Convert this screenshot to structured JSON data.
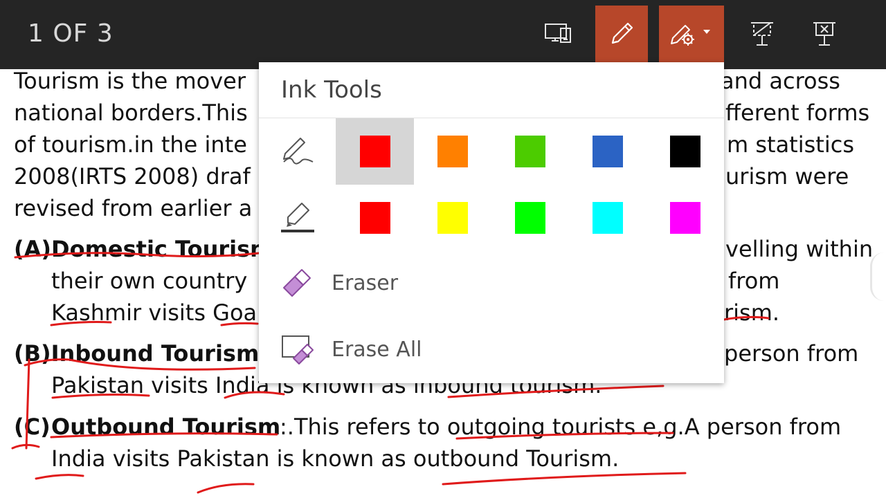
{
  "toolbar": {
    "slide_counter": "1 OF 3",
    "accent": "#b7472a",
    "background": "#252525",
    "buttons": [
      {
        "name": "display-settings-icon"
      },
      {
        "name": "pen-icon",
        "active": true
      },
      {
        "name": "ink-settings-icon",
        "active": true
      },
      {
        "name": "stop-presenting-icon"
      },
      {
        "name": "end-slideshow-icon"
      }
    ]
  },
  "slide": {
    "lines": [
      "Tourism is the mover",
      "and across",
      "national borders.This",
      "fferent forms",
      "of tourism.in the inte",
      "m statistics",
      "2008(IRTS 2008) draf",
      "urism were",
      "revised from earlier a",
      "(A)Domestic Tourism",
      "velling within",
      "their own country",
      "from",
      "Kashmir visits Goa",
      "rism.",
      "(B)Inbound Tourism",
      "person from",
      "Pakistan visits India is known as inbound tourism.",
      "(C)",
      "Outbound Tourism",
      ":.This refers to outgoing tourists e,g.A person from",
      "India visits Pakistan is known as outbound Tourism."
    ],
    "ink_color": "#e01a1a"
  },
  "ink_tools": {
    "title": "Ink Tools",
    "pen_icon": "pen-icon",
    "highlighter_icon": "highlighter-icon",
    "pen_colors": [
      "#ff0000",
      "#ff8000",
      "#4ccc00",
      "#2b63c4",
      "#000000"
    ],
    "highlighter_colors": [
      "#ff0000",
      "#ffff00",
      "#00ff00",
      "#00ffff",
      "#ff00ff"
    ],
    "selected_pen_color": "#ff0000",
    "eraser_label": "Eraser",
    "erase_all_label": "Erase All",
    "eraser_icon": "eraser-icon",
    "erase_all_icon": "erase-all-icon"
  }
}
